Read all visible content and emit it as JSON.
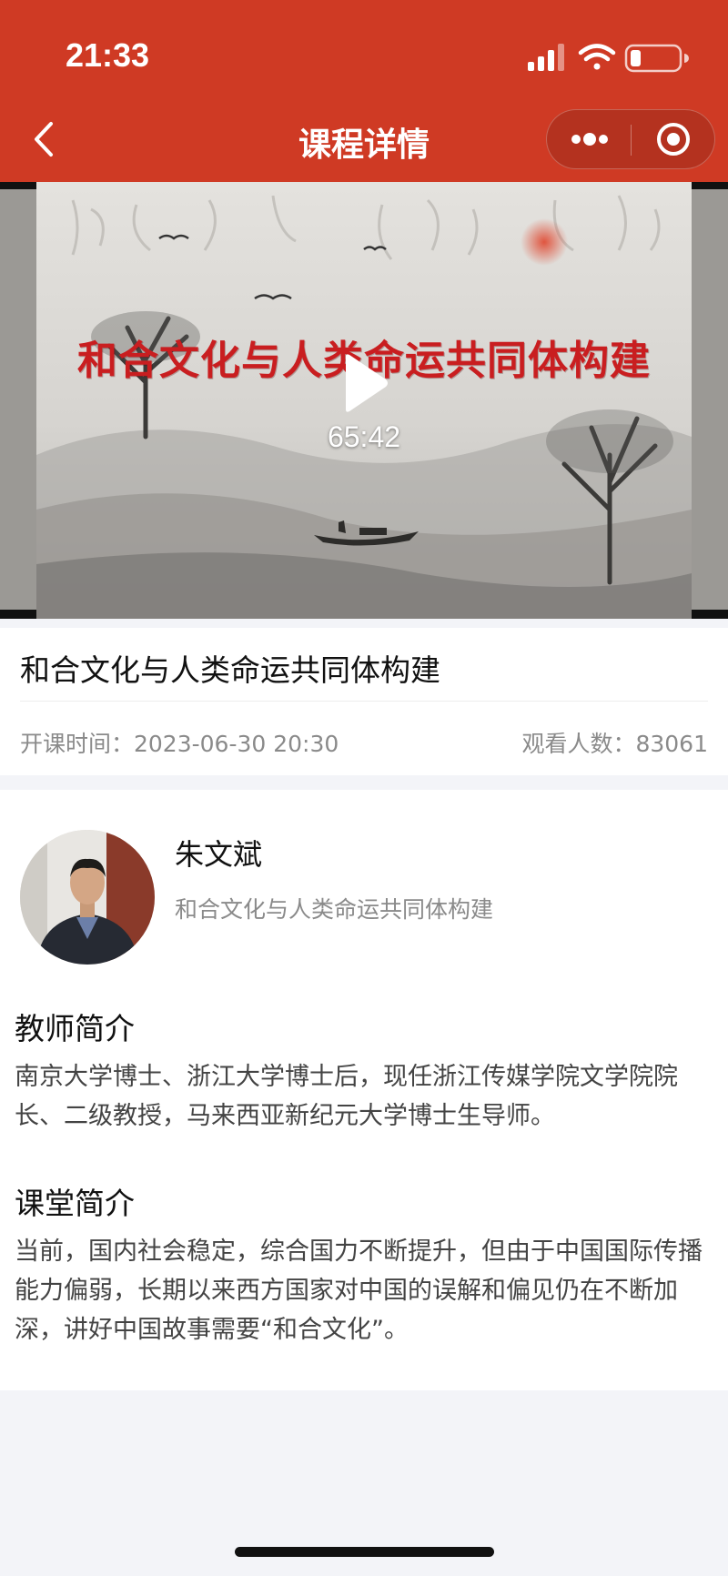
{
  "status_bar": {
    "time": "21:33"
  },
  "nav": {
    "title": "课程详情"
  },
  "video": {
    "cover_title": "和合文化与人类命运共同体构建",
    "duration": "65:42"
  },
  "course": {
    "title": "和合文化与人类命运共同体构建",
    "start_time_label": "开课时间：2023-06-30 20:30",
    "viewers_label": "观看人数：83061"
  },
  "teacher": {
    "name": "朱文斌",
    "course_title": "和合文化与人类命运共同体构建",
    "intro_heading": "教师简介",
    "intro_text": "南京大学博士、浙江大学博士后，现任浙江传媒学院文学院院长、二级教授，马来西亚新纪元大学博士生导师。"
  },
  "class_intro": {
    "heading": "课堂简介",
    "text": "当前，国内社会稳定，综合国力不断提升，但由于中国国际传播能力偏弱，长期以来西方国家对中国的误解和偏见仍在不断加深，讲好中国故事需要“和合文化”。"
  },
  "colors": {
    "header_bg": "#cf3a24",
    "page_bg": "#f3f4f8",
    "cover_title": "#c91e20"
  },
  "icons": {
    "back": "chevron-left-icon",
    "more": "more-dots-icon",
    "close_target": "target-icon",
    "play": "play-icon",
    "signal": "cellular-signal-icon",
    "wifi": "wifi-icon",
    "battery": "battery-icon"
  }
}
